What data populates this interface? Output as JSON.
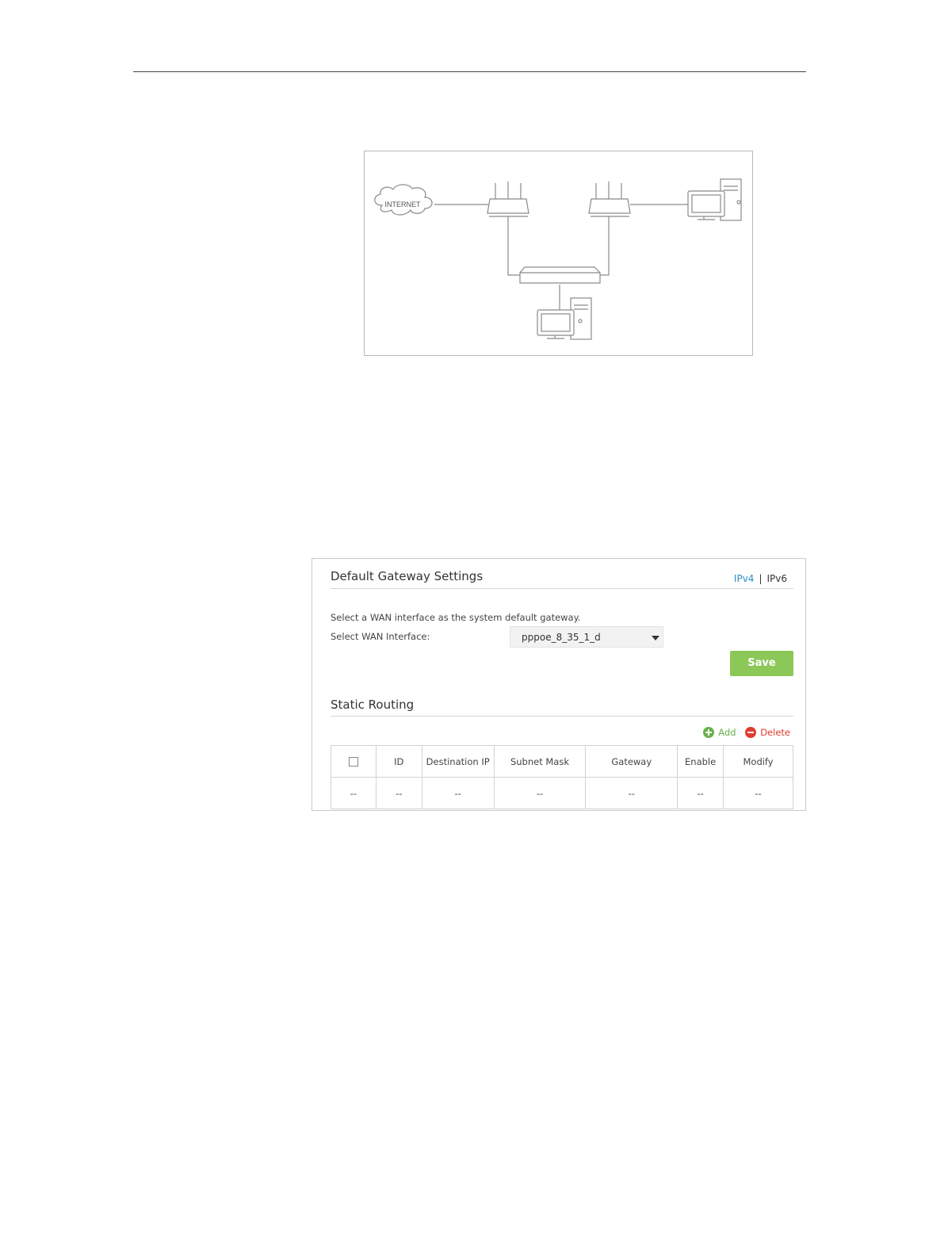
{
  "diagram": {
    "cloud_label": "INTERNET"
  },
  "gateway_panel": {
    "title": "Default Gateway Settings",
    "ip_tabs": [
      "IPv4",
      "IPv6"
    ],
    "active_tab": "IPv4",
    "description": "Select a WAN interface as the system default gateway.",
    "wan_label": "Select WAN Interface:",
    "wan_value": "pppoe_8_35_1_d",
    "save_label": "Save"
  },
  "static_routing": {
    "title": "Static Routing",
    "add_label": "Add",
    "delete_label": "Delete",
    "columns": [
      "ID",
      "Destination IP",
      "Subnet Mask",
      "Gateway",
      "Enable",
      "Modify"
    ],
    "rows": [
      [
        "--",
        "--",
        "--",
        "--",
        "--",
        "--",
        "--"
      ]
    ]
  },
  "colors": {
    "accent_blue": "#2a8fc7",
    "save_green": "#8cc858",
    "add_green": "#6ab04c",
    "delete_red": "#e03c31"
  }
}
